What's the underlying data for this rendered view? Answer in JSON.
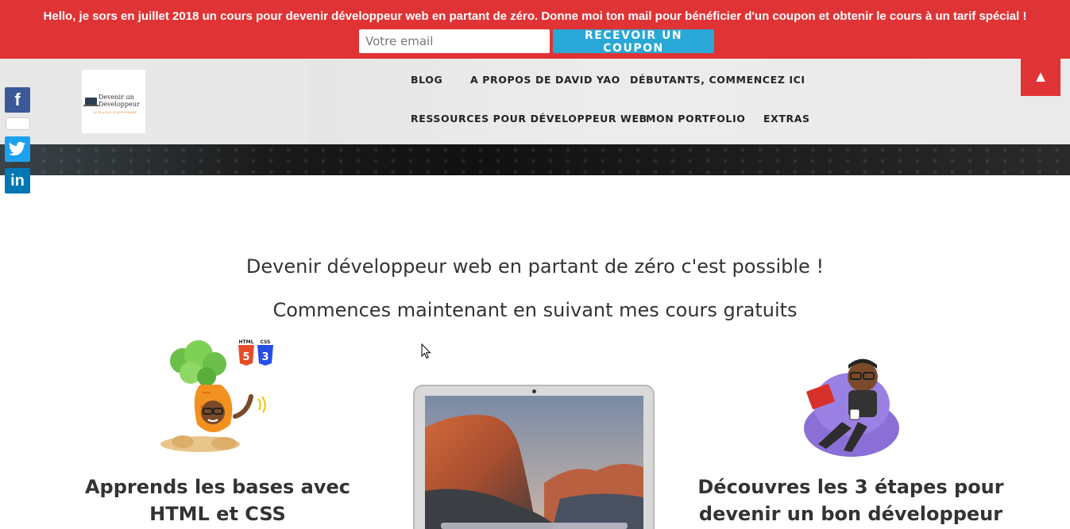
{
  "promo": {
    "message": "Hello, je sors en juillet 2018 un cours pour devenir développeur web en partant de zéro. Donne moi ton mail pour bénéficier d'un coupon et obtenir le cours à un tarif spécial !",
    "email_placeholder": "Votre email",
    "button_label": "RECEVOIR UN COUPON"
  },
  "logo": {
    "line1": "Devenir un",
    "line2": "Développeur",
    "tagline": "LE PLAISIR D'APPRENDRE"
  },
  "nav": {
    "items": [
      "BLOG",
      "A PROPOS DE DAVID YAO",
      "DÉBUTANTS, COMMENCEZ ICI",
      "RESSOURCES POUR DÉVELOPPEUR WEB",
      "MON PORTFOLIO",
      "EXTRAS"
    ]
  },
  "scroll_top_icon": "arrow-up-icon",
  "social": {
    "icons": [
      "facebook-icon",
      "twitter-icon",
      "linkedin-icon"
    ],
    "labels": [
      "f",
      "in"
    ]
  },
  "main": {
    "headline1": "Devenir développeur web en partant de zéro c'est possible !",
    "headline2": "Commences maintenant en suivant mes cours gratuits",
    "cards": [
      {
        "title_line1": "Apprends les bases avec",
        "title_line2": "HTML et CSS"
      },
      {
        "title_line1": "Découvres les 3 étapes pour",
        "title_line2": "devenir un bon développeur"
      }
    ],
    "badges": {
      "html": "HTML",
      "css": "CSS",
      "html_num": "5",
      "css_num": "3"
    }
  },
  "colors": {
    "promo_red": "#e03335",
    "button_blue": "#29a7d6",
    "header_grey": "#e8e8e8",
    "facebook": "#3b5998",
    "twitter": "#1da1f2",
    "linkedin": "#0077b5"
  }
}
